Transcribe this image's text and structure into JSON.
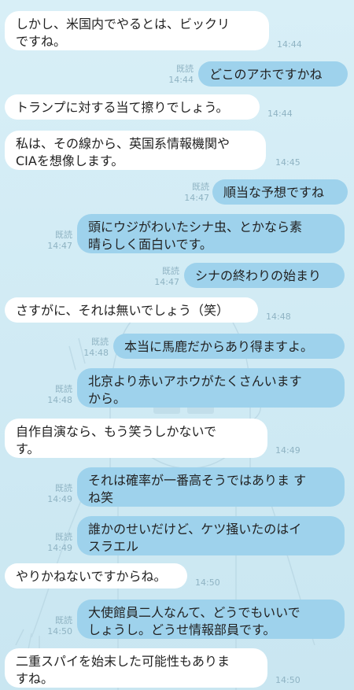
{
  "messages": [
    {
      "dir": "in",
      "text": "しかし、米国内でやるとは、ビックリ\nですね。",
      "time": "14:44"
    },
    {
      "dir": "out",
      "text": "どこのアホですかね",
      "read": "既読",
      "time": "14:44"
    },
    {
      "dir": "in",
      "text": "トランプに対する当て擦りでしょう。",
      "time": "14:44"
    },
    {
      "dir": "in",
      "text": "私は、その線から、英国系情報機関や\nCIAを想像します。",
      "time": "14:45"
    },
    {
      "dir": "out",
      "text": "順当な予想ですね",
      "read": "既読",
      "time": "14:47"
    },
    {
      "dir": "out",
      "text": "頭にウジがわいたシナ虫、とかなら素\n晴らしく面白いです。",
      "read": "既読",
      "time": "14:47"
    },
    {
      "dir": "out",
      "text": "シナの終わりの始まり",
      "read": "既読",
      "time": "14:47"
    },
    {
      "dir": "in",
      "text": "さすがに、それは無いでしょう（笑）",
      "time": "14:48"
    },
    {
      "dir": "out",
      "text": "本当に馬鹿だからあり得ますよ。",
      "read": "既読",
      "time": "14:48"
    },
    {
      "dir": "out",
      "text": "北京より赤いアホウがたくさんいます\nから。",
      "read": "既読",
      "time": "14:48"
    },
    {
      "dir": "in",
      "text": "自作自演なら、もう笑うしかないで\nす。",
      "time": "14:49"
    },
    {
      "dir": "out",
      "text": "それは確率が一番高そうではありま す\nね笑",
      "read": "既読",
      "time": "14:49"
    },
    {
      "dir": "out",
      "text": "誰かのせいだけど、ケツ掻いたのはイ\nスラエル",
      "read": "既読",
      "time": "14:49"
    },
    {
      "dir": "in",
      "text": "やりかねないですからね。",
      "time": "14:50"
    },
    {
      "dir": "out",
      "text": "大使館員二人なんて、どうでもいいで\nしょうし。どうせ情報部員です。",
      "read": "既読",
      "time": "14:50"
    },
    {
      "dir": "in",
      "text": "二重スパイを始末した可能性もありま\nすね。",
      "time": "14:50"
    }
  ],
  "colors": {
    "incoming_bubble": "#ffffff",
    "outgoing_bubble": "#9ed2ec",
    "background": "#cfe9f3",
    "meta_text": "#8fb3c3"
  }
}
